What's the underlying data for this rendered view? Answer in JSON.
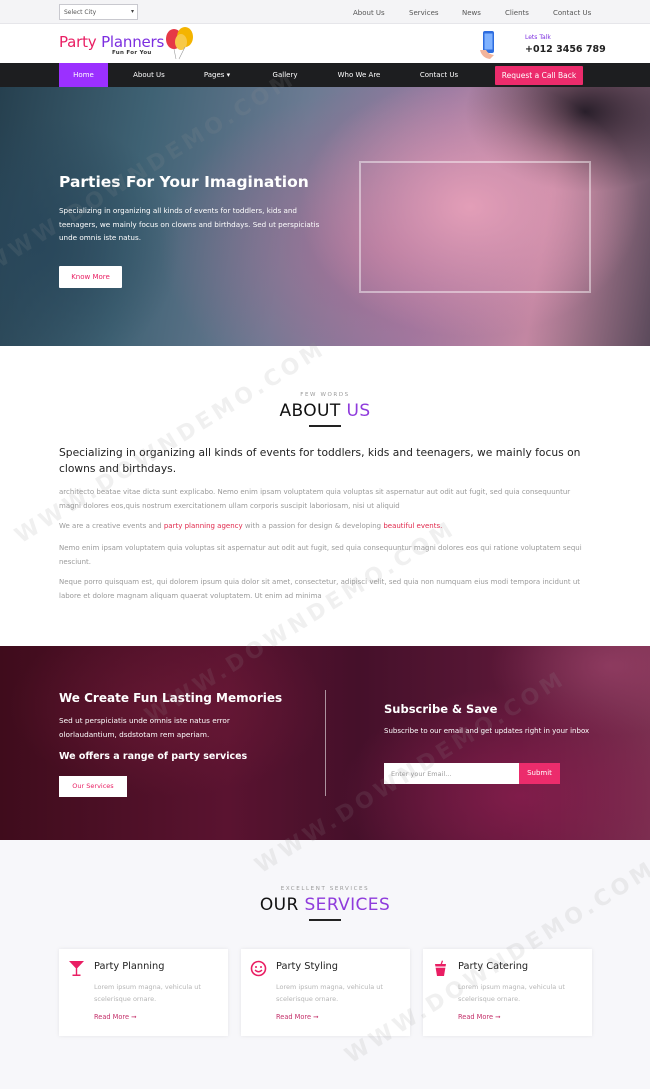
{
  "topbar": {
    "city_select": "Select City",
    "links": [
      "About Us",
      "Services",
      "News",
      "Clients",
      "Contact Us"
    ]
  },
  "brand": {
    "name_part1": "Party",
    "name_part2": "Planners",
    "tagline": "Fun For You",
    "lets_talk": "Lets Talk",
    "phone": "+012 3456 789"
  },
  "nav": {
    "items": [
      "Home",
      "About Us",
      "Pages",
      "Gallery",
      "Who We Are",
      "Contact Us"
    ],
    "active": "Home",
    "cta": "Request a Call Back"
  },
  "hero": {
    "title": "Parties For Your Imagination",
    "text": "Specializing in organizing all kinds of events for toddlers, kids and teenagers, we mainly focus on clowns and birthdays. Sed ut perspiciatis unde omnis iste natus.",
    "button": "Know More"
  },
  "about": {
    "eyebrow": "FEW WORDS",
    "title_a": "ABOUT",
    "title_b": "US",
    "lead": "Specializing in organizing all kinds of events for toddlers, kids and teenagers, we mainly focus on clowns and birthdays.",
    "p1": "architecto beatae vitae dicta sunt explicabo. Nemo enim ipsam voluptatem quia voluptas sit aspernatur aut odit aut fugit, sed quia consequuntur magni dolores eos,quis nostrum exercitationem ullam corporis suscipit laboriosam, nisi ut aliquid",
    "p2_a": "We are a creative events and",
    "p2_link1": "party planning agency",
    "p2_b": "with a passion for design & developing",
    "p2_link2": "beautiful events.",
    "p3": "Nemo enim ipsam voluptatem quia voluptas sit aspernatur aut odit aut fugit, sed quia consequuntur magni dolores eos qui ratione voluptatem sequi nesciunt.",
    "p4": "Neque porro quisquam est, qui dolorem ipsum quia dolor sit amet, consectetur, adipisci velit, sed quia non numquam eius modi tempora incidunt ut labore et dolore magnam aliquam quaerat voluptatem. Ut enim ad minima"
  },
  "promo": {
    "title": "We Create Fun Lasting Memories",
    "text": "Sed ut perspiciatis unde omnis iste natus error olorlaudantium, dsdstotam rem aperiam.",
    "subtitle": "We offers a range of party services",
    "button": "Our Services",
    "subscribe_title": "Subscribe & Save",
    "subscribe_text": "Subscribe to our email and get updates right in your inbox",
    "email_placeholder": "Enter your Email...",
    "submit": "Submit"
  },
  "services": {
    "eyebrow": "EXCELLENT SERVICES",
    "title_a": "OUR",
    "title_b": "SERVICES",
    "cards": [
      {
        "icon": "cocktail-glass-icon",
        "title": "Party Planning",
        "desc": "Lorem ipsum magna, vehicula ut scelerisque ornare.",
        "more": "Read More ➞"
      },
      {
        "icon": "smiley-face-icon",
        "title": "Party Styling",
        "desc": "Lorem ipsum magna, vehicula ut scelerisque ornare.",
        "more": "Read More ➞"
      },
      {
        "icon": "drink-cup-icon",
        "title": "Party Catering",
        "desc": "Lorem ipsum magna, vehicula ut scelerisque ornare.",
        "more": "Read More ➞"
      }
    ]
  },
  "watermark": "WWW.DOWNDEMO.COM",
  "colors": {
    "accent_pink": "#ec2c6c",
    "accent_purple": "#9b30ff",
    "nav_bg": "#1d1e20"
  }
}
